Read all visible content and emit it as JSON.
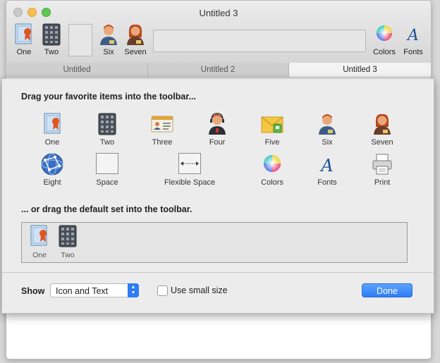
{
  "window": {
    "title": "Untitled 3",
    "toolbar": [
      {
        "label": "One",
        "icon": "certificate-icon"
      },
      {
        "label": "Two",
        "icon": "calculator-icon"
      },
      {
        "label": "Six",
        "icon": "person-male-icon"
      },
      {
        "label": "Seven",
        "icon": "person-female-icon"
      },
      {
        "label": "Colors",
        "icon": "color-wheel-icon"
      },
      {
        "label": "Fonts",
        "icon": "font-icon"
      }
    ],
    "tabs": [
      {
        "label": "Untitled"
      },
      {
        "label": "Untitled 2"
      },
      {
        "label": "Untitled 3"
      }
    ]
  },
  "sheet": {
    "heading_items": "Drag your favorite items into the toolbar...",
    "palette": [
      {
        "label": "One",
        "icon": "certificate-icon"
      },
      {
        "label": "Two",
        "icon": "calculator-icon"
      },
      {
        "label": "Three",
        "icon": "id-card-icon"
      },
      {
        "label": "Four",
        "icon": "headset-person-icon"
      },
      {
        "label": "Five",
        "icon": "mail-icon"
      },
      {
        "label": "Six",
        "icon": "person-male-icon"
      },
      {
        "label": "Seven",
        "icon": "person-female-icon"
      },
      {
        "label": "Eight",
        "icon": "network-globe-icon"
      },
      {
        "label": "Space",
        "icon": "space-icon"
      },
      {
        "label": "Flexible Space",
        "icon": "flexible-space-icon"
      },
      {
        "label": "Colors",
        "icon": "color-wheel-icon"
      },
      {
        "label": "Fonts",
        "icon": "font-icon"
      },
      {
        "label": "Print",
        "icon": "printer-icon"
      }
    ],
    "heading_default": "... or drag the default set into the toolbar.",
    "default_set": [
      {
        "label": "One",
        "icon": "certificate-icon"
      },
      {
        "label": "Two",
        "icon": "calculator-icon"
      }
    ],
    "show_label": "Show",
    "show_value": "Icon and Text",
    "small_size_label": "Use small size",
    "small_size_checked": false,
    "done_label": "Done"
  },
  "colors": {
    "accent": "#2f7cf6"
  }
}
